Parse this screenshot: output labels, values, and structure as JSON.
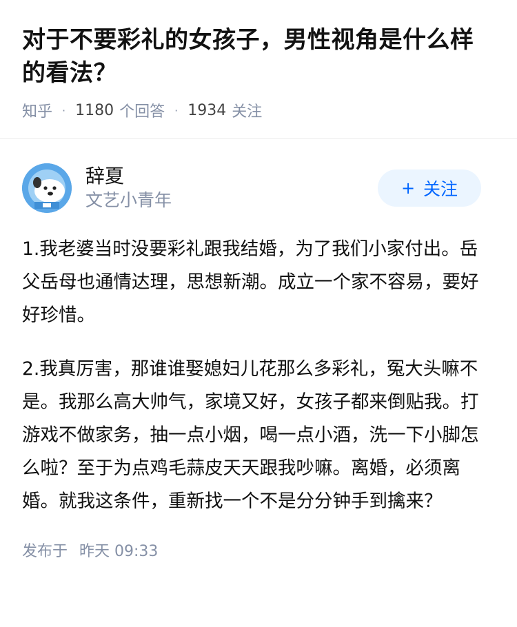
{
  "question": {
    "title": "对于不要彩礼的女孩子，男性视角是什么样的看法？",
    "source": "知乎",
    "answer_count": "1180",
    "answer_label": "个回答",
    "follower_count": "1934",
    "follower_label": "关注"
  },
  "answer": {
    "author": {
      "name": "辞夏",
      "bio": "文艺小青年",
      "follow_label": "关注",
      "follow_plus": "+"
    },
    "paragraphs": [
      "1.我老婆当时没要彩礼跟我结婚，为了我们小家付出。岳父岳母也通情达理，思想新潮。成立一个家不容易，要好好珍惜。",
      "2.我真厉害，那谁谁娶媳妇儿花那么多彩礼，冤大头嘛不是。我那么高大帅气，家境又好，女孩子都来倒贴我。打游戏不做家务，抽一点小烟，喝一点小酒，洗一下小脚怎么啦？至于为点鸡毛蒜皮天天跟我吵嘛。离婚，必须离婚。就我这条件，重新找一个不是分分钟手到擒来？"
    ],
    "publish_label": "发布于",
    "publish_time": "昨天 09:33"
  },
  "colors": {
    "accent": "#0066ff",
    "follow_bg": "#ebf5ff",
    "meta": "#8590a6",
    "avatar_bg": "#5aa7e8"
  }
}
